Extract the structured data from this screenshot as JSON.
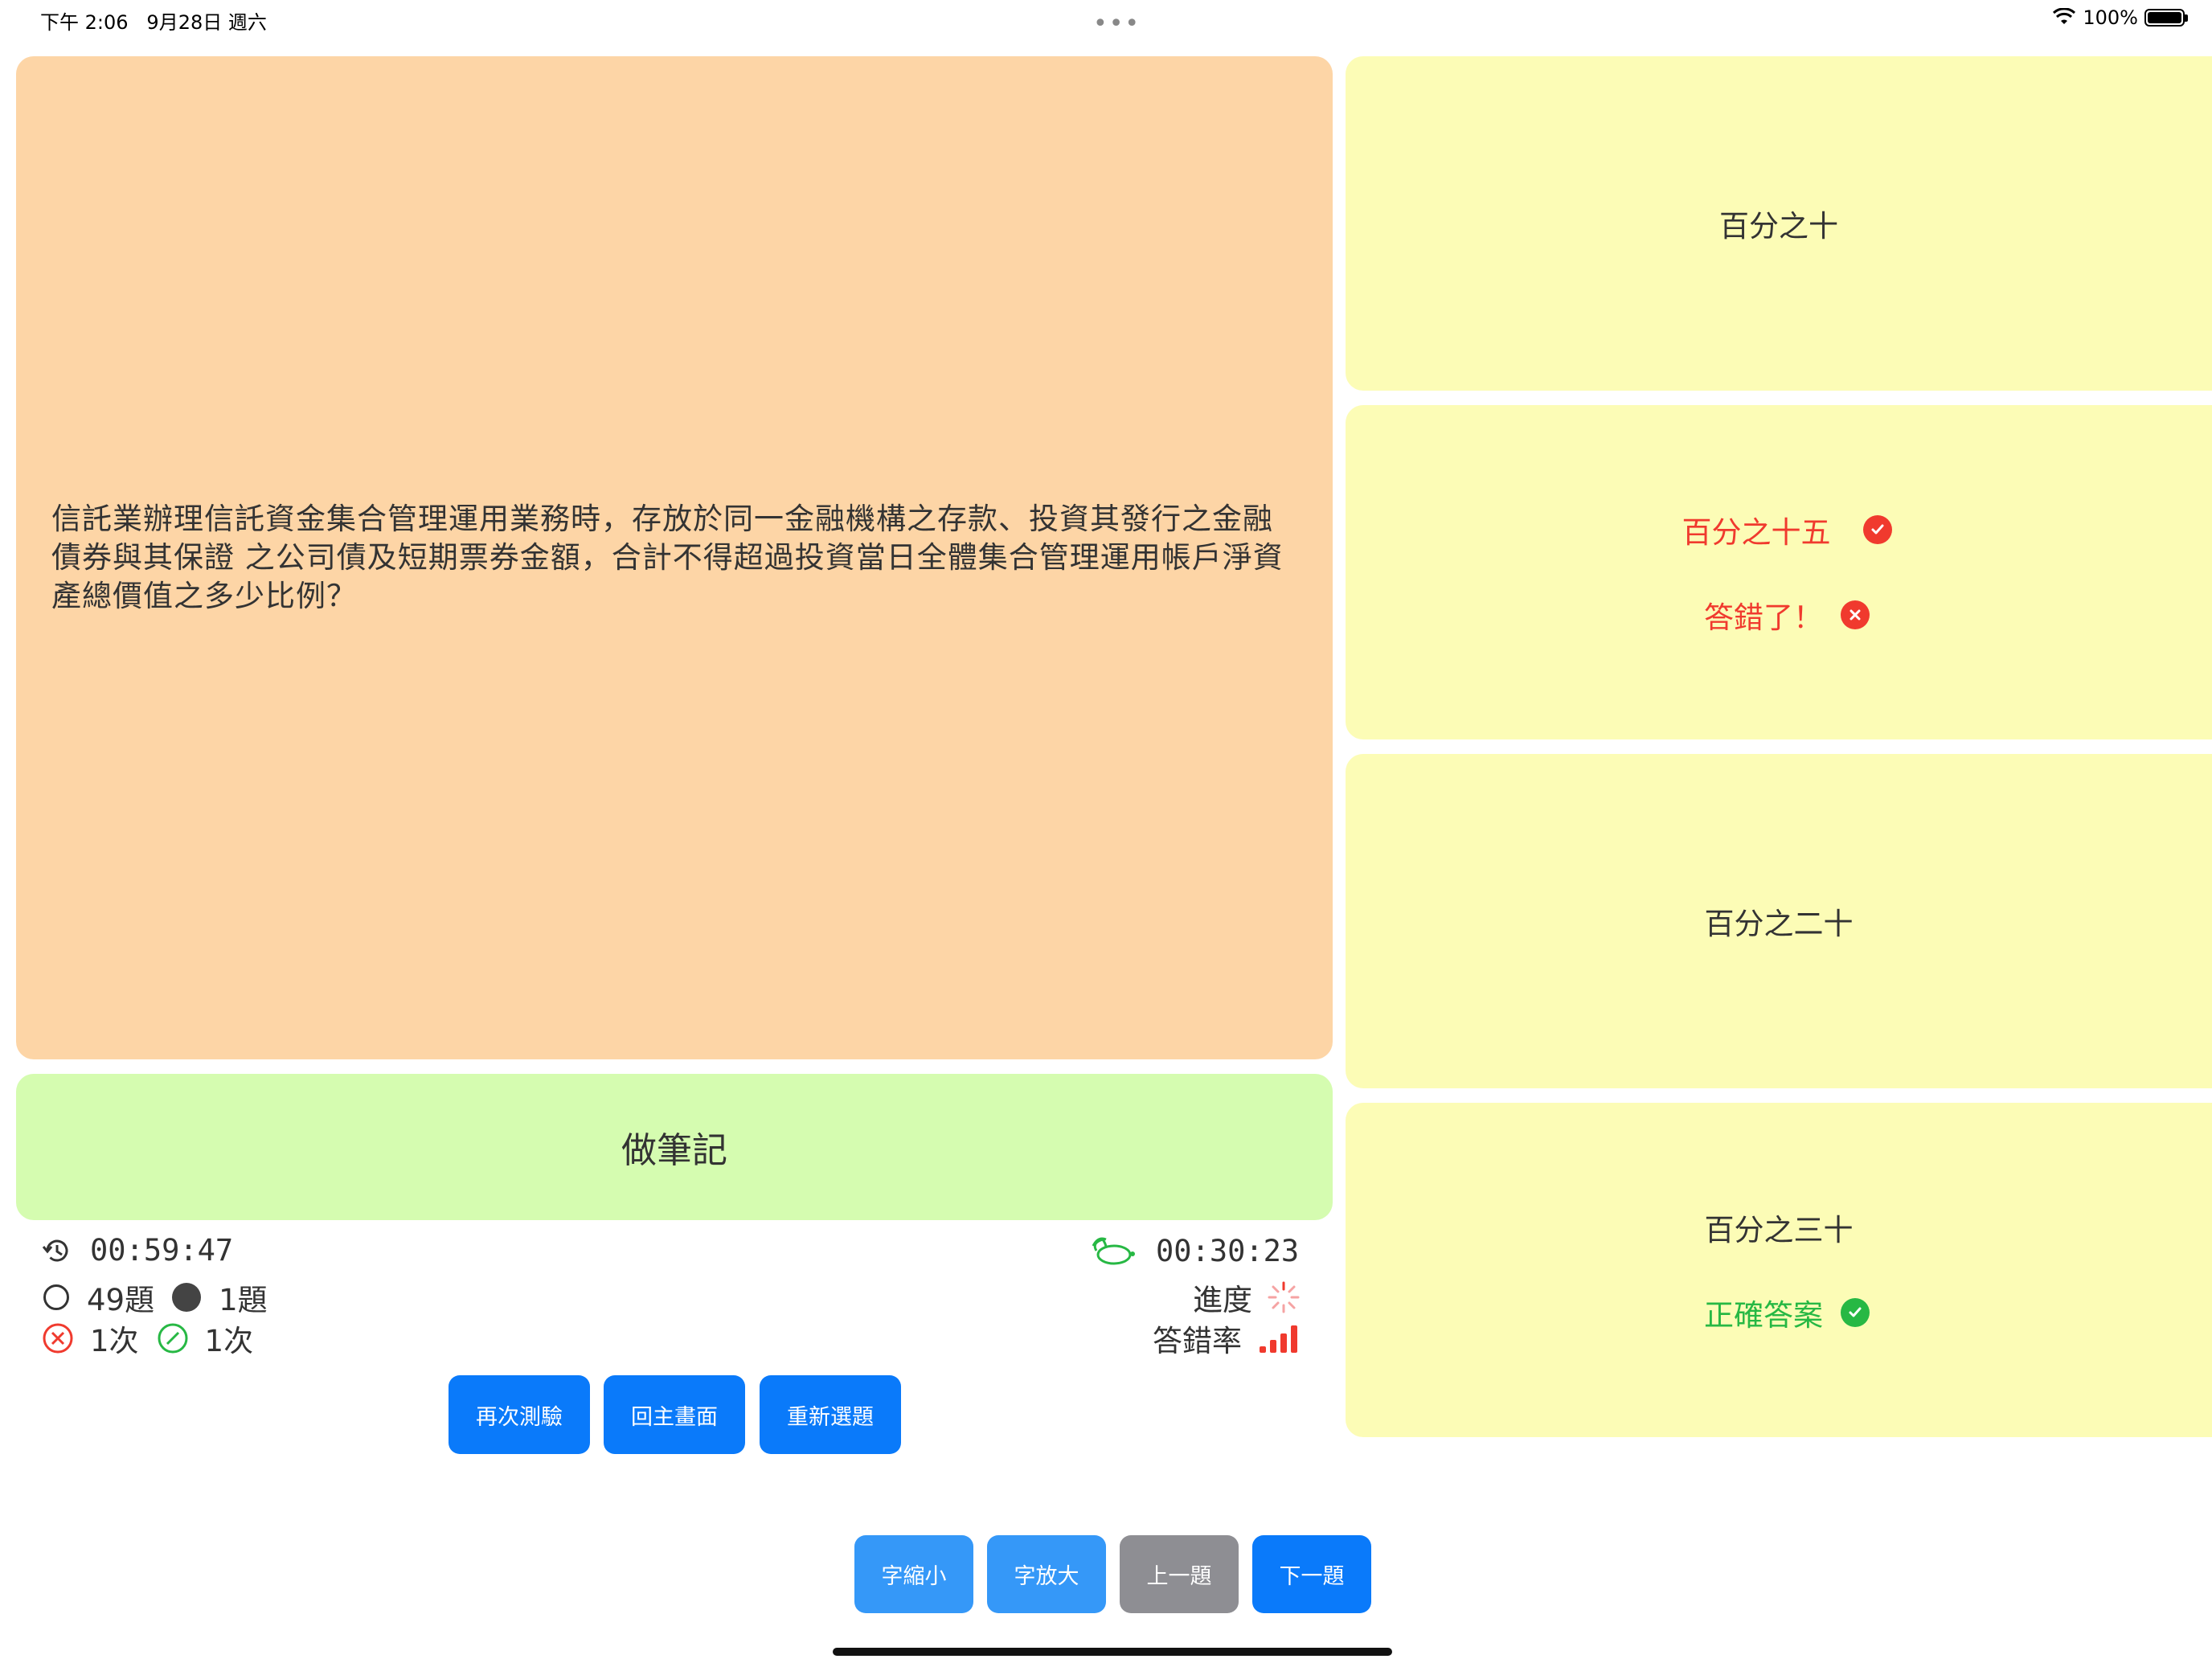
{
  "status_bar": {
    "time": "下午 2:06",
    "date": "9月28日 週六",
    "battery": "100%"
  },
  "question": {
    "text": "信託業辦理信託資金集合管理運用業務時，存放於同一金融機構之存款、投資其發行之金融債券與其保證 之公司債及短期票券金額，合計不得超過投資當日全體集合管理運用帳戶淨資產總價值之多少比例？"
  },
  "note_button": {
    "label": "做筆記"
  },
  "stats": {
    "elapsed_time": "00:59:47",
    "unanswered": "49題",
    "answered": "1題",
    "wrong_count": "1次",
    "correct_count": "1次",
    "rabbit_time": "00:30:23",
    "progress_label": "進度",
    "error_rate_label": "答錯率"
  },
  "action_buttons": {
    "retest": "再次測驗",
    "home": "回主畫面",
    "reselect": "重新選題"
  },
  "nav_buttons": {
    "font_smaller": "字縮小",
    "font_larger": "字放大",
    "prev": "上一題",
    "next": "下一題"
  },
  "answers": [
    {
      "text": "百分之十"
    },
    {
      "text": "百分之十五",
      "feedback": "答錯了！"
    },
    {
      "text": "百分之二十"
    },
    {
      "text": "百分之三十",
      "feedback": "正確答案"
    }
  ],
  "colors": {
    "question_bg": "#fdd5a6",
    "note_bg": "#d5fcb0",
    "answer_bg": "#fcfcb6",
    "primary_blue": "#0a7afa",
    "wrong_red": "#f03a2e",
    "correct_green": "#27b844"
  }
}
